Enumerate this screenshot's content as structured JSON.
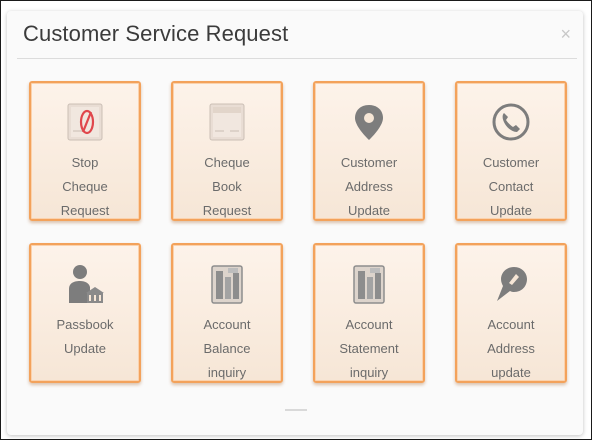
{
  "dialog": {
    "title": "Customer Service Request",
    "close_glyph": "×"
  },
  "tiles": [
    {
      "label": "Stop\nCheque\nRequest",
      "icon": "stop-cheque-icon"
    },
    {
      "label": "Cheque\nBook\nRequest",
      "icon": "cheque-book-icon"
    },
    {
      "label": "Customer\nAddress\nUpdate",
      "icon": "map-pin-icon"
    },
    {
      "label": "Customer\nContact\nUpdate",
      "icon": "phone-icon"
    },
    {
      "label": "Passbook\nUpdate",
      "icon": "passbook-user-icon"
    },
    {
      "label": "Account\nBalance\ninquiry",
      "icon": "balance-document-icon"
    },
    {
      "label": "Account\nStatement\ninquiry",
      "icon": "statement-document-icon"
    },
    {
      "label": "Account\nAddress\nupdate",
      "icon": "address-pin-icon"
    }
  ],
  "colors": {
    "tile_border": "#f3a25b",
    "icon_gray": "#7d7d7d"
  }
}
